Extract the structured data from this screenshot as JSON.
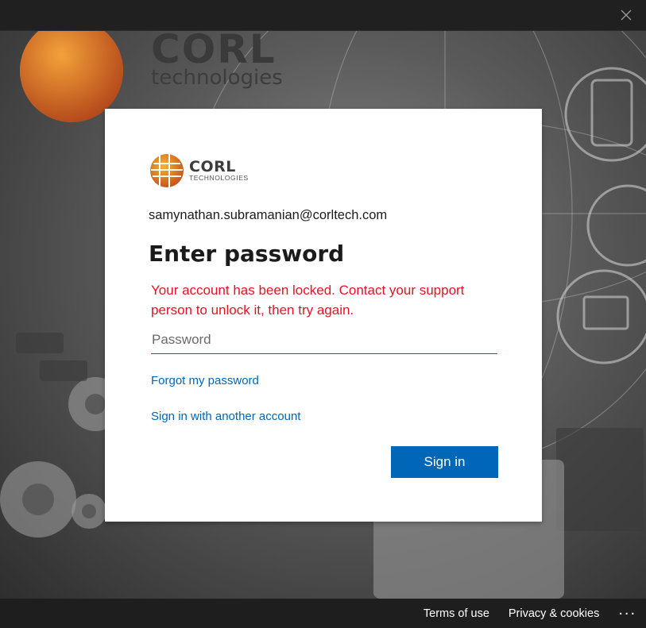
{
  "window": {
    "close_icon": "close-icon"
  },
  "background": {
    "brand_name": "CORL",
    "brand_sub": "technologies"
  },
  "dialog": {
    "logo": {
      "name": "CORL",
      "sub": "TECHNOLOGIES"
    },
    "email": "samynathan.subramanian@corltech.com",
    "title": "Enter password",
    "error": "Your account has been locked. Contact your support person to unlock it, then try again.",
    "password_placeholder": "Password",
    "forgot_link": "Forgot my password",
    "other_account_link": "Sign in with another account",
    "sign_in_button": "Sign in"
  },
  "footer": {
    "terms": "Terms of use",
    "privacy": "Privacy & cookies",
    "more": "..."
  },
  "colors": {
    "accent": "#0067b8",
    "error": "#e81123"
  }
}
